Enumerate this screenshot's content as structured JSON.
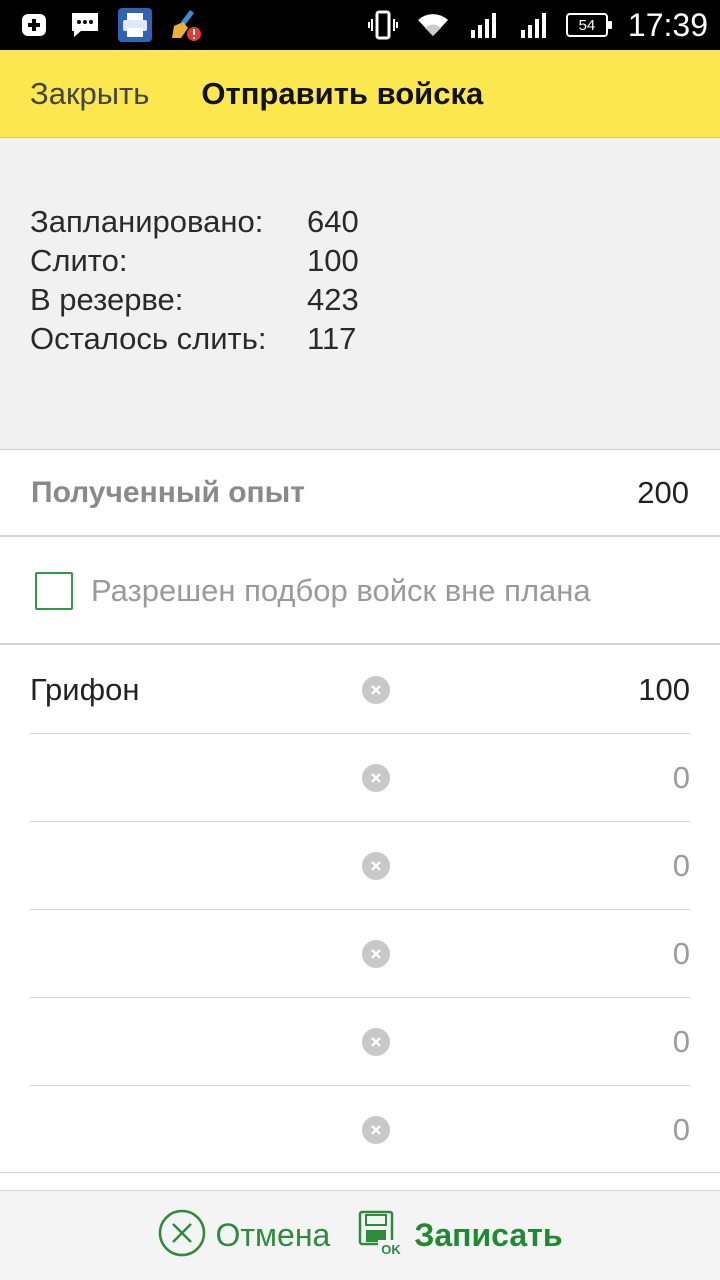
{
  "status_bar": {
    "time": "17:39",
    "battery": "54",
    "icons": [
      "add-icon",
      "message-icon",
      "printer-icon",
      "cleaner-icon",
      "vibrate-icon",
      "wifi-icon",
      "signal-1-icon",
      "signal-2-icon",
      "battery-icon"
    ]
  },
  "header": {
    "close_label": "Закрыть",
    "title": "Отправить войска"
  },
  "stats": [
    {
      "label": "Запланировано:",
      "value": "640"
    },
    {
      "label": "Слито:",
      "value": "100"
    },
    {
      "label": "В резерве:",
      "value": "423"
    },
    {
      "label": "Осталось слить:",
      "value": "117"
    }
  ],
  "experience": {
    "label": "Полученный опыт",
    "value": "200"
  },
  "allow_unplanned": {
    "label": "Разрешен подбор войск вне плана",
    "checked": false
  },
  "troops": [
    {
      "name": "Грифон",
      "qty": "100"
    },
    {
      "name": "",
      "qty": "0"
    },
    {
      "name": "",
      "qty": "0"
    },
    {
      "name": "",
      "qty": "0"
    },
    {
      "name": "",
      "qty": "0"
    },
    {
      "name": "",
      "qty": "0"
    }
  ],
  "footer": {
    "cancel_label": "Отмена",
    "save_label": "Записать"
  },
  "colors": {
    "header_bg": "#fbe84f",
    "accent_green": "#2e8b3e",
    "stats_bg": "#f1f1f1"
  }
}
